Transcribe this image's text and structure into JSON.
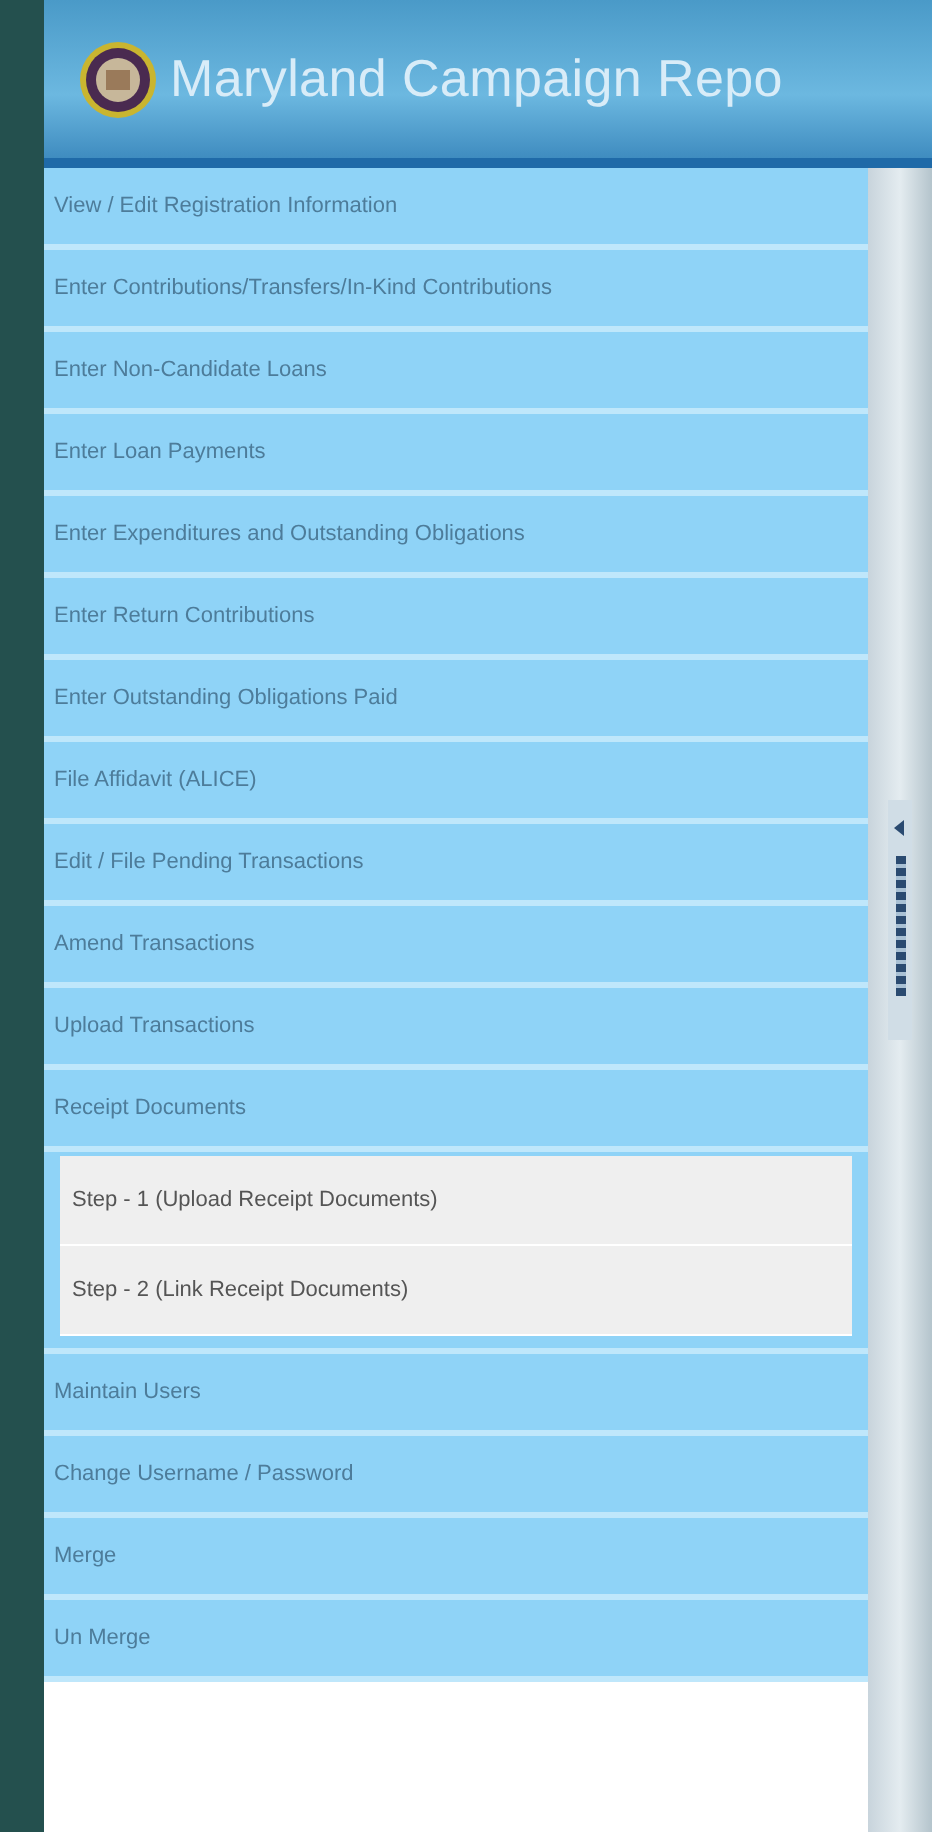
{
  "header": {
    "title": "Maryland Campaign Repo"
  },
  "menu": [
    {
      "label": "View / Edit Registration Information"
    },
    {
      "label": "Enter Contributions/Transfers/In-Kind Contributions"
    },
    {
      "label": "Enter Non-Candidate Loans"
    },
    {
      "label": "Enter Loan Payments"
    },
    {
      "label": "Enter Expenditures and Outstanding Obligations"
    },
    {
      "label": "Enter Return Contributions"
    },
    {
      "label": "Enter Outstanding Obligations Paid"
    },
    {
      "label": "File Affidavit (ALICE)"
    },
    {
      "label": "Edit / File Pending Transactions"
    },
    {
      "label": "Amend Transactions"
    },
    {
      "label": "Upload Transactions"
    },
    {
      "label": "Receipt Documents",
      "children": [
        {
          "label": "Step - 1 (Upload Receipt Documents)"
        },
        {
          "label": "Step - 2 (Link Receipt Documents)"
        }
      ]
    },
    {
      "label": "Maintain Users"
    },
    {
      "label": "Change Username / Password"
    },
    {
      "label": "Merge"
    },
    {
      "label": "Un Merge"
    }
  ]
}
